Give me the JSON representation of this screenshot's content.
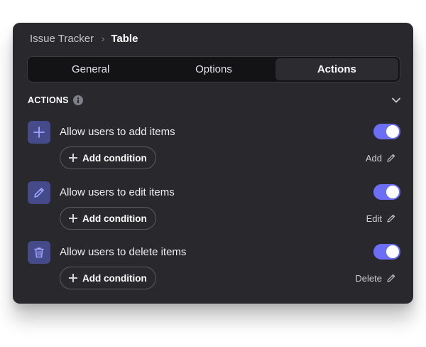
{
  "breadcrumb": {
    "parent": "Issue Tracker",
    "separator": "›",
    "current": "Table"
  },
  "tabs": [
    {
      "label": "General",
      "active": false
    },
    {
      "label": "Options",
      "active": false
    },
    {
      "label": "Actions",
      "active": true
    }
  ],
  "section": {
    "title": "ACTIONS",
    "info_icon": "info-icon",
    "collapse_icon": "chevron-down-icon"
  },
  "actions": [
    {
      "icon": "plus-icon",
      "label": "Allow users to add items",
      "enabled": true,
      "condition_label": "Add condition",
      "edit_label": "Add"
    },
    {
      "icon": "pencil-icon",
      "label": "Allow users to edit items",
      "enabled": true,
      "condition_label": "Add condition",
      "edit_label": "Edit"
    },
    {
      "icon": "trash-icon",
      "label": "Allow users to delete items",
      "enabled": true,
      "condition_label": "Add condition",
      "edit_label": "Delete"
    }
  ],
  "colors": {
    "panel": "#29292d",
    "accent": "#6c6ff5",
    "icon_bg": "#454a8a",
    "tab_bar": "#131315"
  }
}
